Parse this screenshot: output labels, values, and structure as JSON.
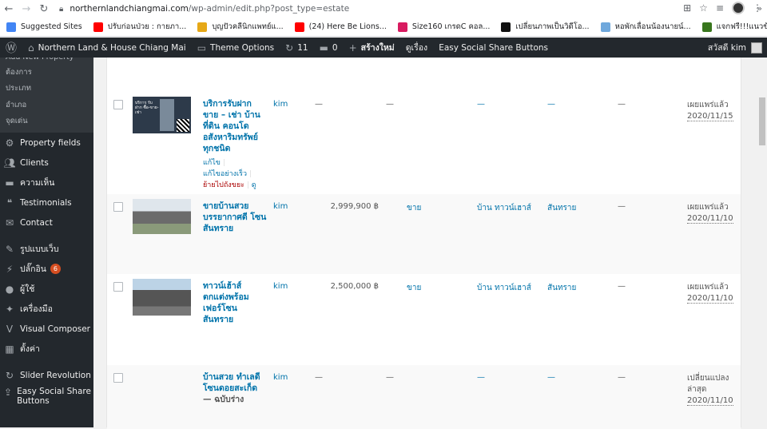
{
  "browser": {
    "url_domain": "northernlandchiangmai.com",
    "url_path": "/wp-admin/edit.php?post_type=estate",
    "bookmarks": [
      {
        "label": "Suggested Sites",
        "color": "#4285f4"
      },
      {
        "label": "ปรับก่อนป่วย : กายภา...",
        "color": "#ff0000"
      },
      {
        "label": "บุญปัวคลีนิกแพทย์แ...",
        "color": "#e6a817"
      },
      {
        "label": "(24) Here Be Lions...",
        "color": "#ff0000"
      },
      {
        "label": "Size160 เกรดC คอล...",
        "color": "#d81b60"
      },
      {
        "label": "เปลี่ยนภาพเป็นวิดีโอ...",
        "color": "#111111"
      },
      {
        "label": "หอพักเลื่อนน้องนายน์...",
        "color": "#6fa8dc"
      },
      {
        "label": "แจกฟรี!!!แนวข้อสอบ...",
        "color": "#38761d"
      }
    ],
    "more": "»"
  },
  "adminbar": {
    "site_name": "Northern Land & House Chiang Mai",
    "theme_options": "Theme Options",
    "updates": "11",
    "comments": "0",
    "new": "สร้างใหม่",
    "view": "ดูเรื่อง",
    "social": "Easy Social Share Buttons",
    "greeting": "สวัสดี kim"
  },
  "sidebar": {
    "submenu": [
      "Add New Property",
      "ต้องการ",
      "ประเภท",
      "อำเภอ",
      "จุดเด่น"
    ],
    "items": [
      {
        "label": "Property fields",
        "icon": "gear-icon"
      },
      {
        "label": "Clients",
        "icon": "users-icon"
      },
      {
        "label": "ความเห็น",
        "icon": "comment-icon"
      },
      {
        "label": "Testimonials",
        "icon": "quote-icon"
      },
      {
        "label": "Contact",
        "icon": "mail-icon"
      },
      {
        "label": "รูปแบบเว็บ",
        "icon": "brush-icon"
      },
      {
        "label": "ปลั๊กอิน",
        "icon": "plugin-icon",
        "badge": "6"
      },
      {
        "label": "ผู้ใช้",
        "icon": "user-icon"
      },
      {
        "label": "เครื่องมือ",
        "icon": "wrench-icon"
      },
      {
        "label": "Visual Composer",
        "icon": "vc-icon"
      },
      {
        "label": "ตั้งค่า",
        "icon": "settings-icon"
      },
      {
        "label": "Slider Revolution",
        "icon": "refresh-icon"
      },
      {
        "label": "Easy Social Share Buttons",
        "icon": "share-icon"
      }
    ]
  },
  "rows": [
    {
      "title": "บริการรับฝาก ขาย – เช่า บ้าน ที่ดิน คอนโด อสังหาริมทรัพย์ ทุกชนิด",
      "actions": {
        "edit": "แก้ไข",
        "quick": "แก้ไขอย่างเร็ว",
        "trash": "ย้ายไปถังขยะ",
        "view": "ดู"
      },
      "author": "kim",
      "price": "—",
      "type": "—",
      "ptype": "—",
      "area": "—",
      "x": "—",
      "status": "เผยแพร่แล้ว",
      "date": "2020/11/15",
      "thumb_text": "บริการ รับฝาก ซื้อ-ขาย-เช่า"
    },
    {
      "title": "ขายบ้านสวย บรรยากาศดี โซนสันทราย",
      "author": "kim",
      "price": "2,999,900 ฿",
      "type": "ขาย",
      "ptype": "บ้าน ทาวน์เฮาส์",
      "area": "สันทราย",
      "x": "—",
      "status": "เผยแพร่แล้ว",
      "date": "2020/11/10"
    },
    {
      "title": "ทาวน์เฮ้าส์ ตกแต่งพร้อม เฟอร์โซน สันทราย",
      "author": "kim",
      "price": "2,500,000 ฿",
      "type": "ขาย",
      "ptype": "บ้าน ทาวน์เฮาส์",
      "area": "สันทราย",
      "x": "—",
      "status": "เผยแพร่แล้ว",
      "date": "2020/11/10"
    },
    {
      "title": "บ้านสวย ทำเลดี โซนดอยสะเก็ด",
      "draft": "— ฉบับร่าง",
      "author": "kim",
      "price": "—",
      "type": "—",
      "ptype": "—",
      "area": "—",
      "x": "—",
      "status": "เปลี่ยนแปลงล่าสุด",
      "date": "2020/11/10"
    }
  ]
}
